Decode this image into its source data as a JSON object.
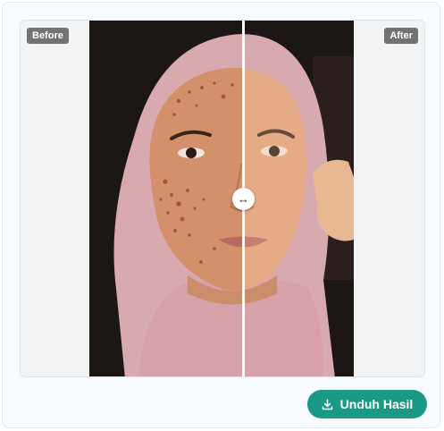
{
  "comparison": {
    "before_label": "Before",
    "after_label": "After",
    "handle_icon": "↔",
    "slider_position": 0.52
  },
  "actions": {
    "download_label": "Unduh Hasil",
    "download_icon": "download-icon"
  },
  "colors": {
    "accent": "#1a9a86",
    "tag_background": "#5a5a5a"
  }
}
